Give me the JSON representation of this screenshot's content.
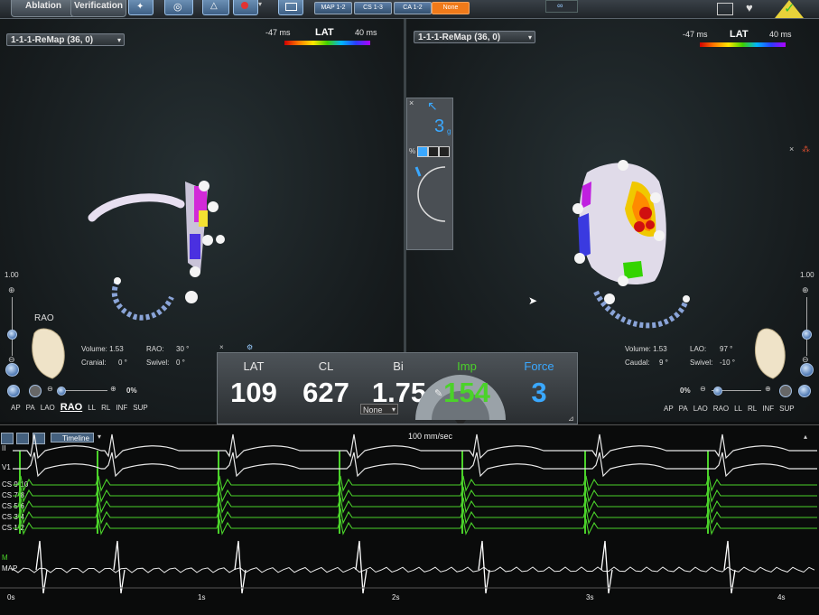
{
  "topbar": {
    "tabs": [
      "Ablation",
      "Verification"
    ],
    "seg_buttons": [
      "MAP 1-2",
      "CS 1-3",
      "CA 1-2",
      "None"
    ]
  },
  "left_pane": {
    "map_selector": "1-1-1-ReMap (36, 0)",
    "lat_title": "LAT",
    "lat_min": "-47 ms",
    "lat_max": "40 ms",
    "zoom_value": "1.00",
    "view_label": "RAO",
    "volume": "Volume: 1.53",
    "angle1_label": "RAO:",
    "angle1_value": "30 °",
    "angle2_label": "Cranial:",
    "angle2_value": "0 °",
    "angle3_label": "Swivel:",
    "angle3_value": "0 °",
    "opacity": "0%",
    "view_nav": [
      "AP",
      "PA",
      "LAO",
      "RAO",
      "LL",
      "RL",
      "INF",
      "SUP"
    ],
    "view_nav_selected": "RAO"
  },
  "right_pane": {
    "map_selector": "1-1-1-ReMap (36, 0)",
    "lat_title": "LAT",
    "lat_min": "-47 ms",
    "lat_max": "40 ms",
    "zoom_value": "1.00",
    "volume": "Volume: 1.53",
    "angle1_label": "LAO:",
    "angle1_value": "97 °",
    "angle2_label": "Caudal:",
    "angle2_value": "9 °",
    "angle3_label": "Swivel:",
    "angle3_value": "-10 °",
    "opacity": "0%",
    "view_nav": [
      "AP",
      "PA",
      "LAO",
      "RAO",
      "LL",
      "RL",
      "INF",
      "SUP"
    ]
  },
  "float_panel": {
    "close": "×",
    "value": "3",
    "unit": "g",
    "pct": "%"
  },
  "metrics": {
    "lat_label": "LAT",
    "lat_value": "109",
    "cl_label": "CL",
    "cl_value": "627",
    "bi_label": "Bi",
    "bi_value": "1.75",
    "imp_label": "Imp",
    "imp_value": "154",
    "force_label": "Force",
    "force_value": "3",
    "none_select": "None"
  },
  "ecg": {
    "timeline_label": "Timeline",
    "speed": "100 mm/sec",
    "channels": [
      "II",
      "V1",
      "CS 9-10",
      "CS 7-8",
      "CS 5-6",
      "CS 3-4",
      "CS 1-2",
      "M",
      "MAP"
    ],
    "time_ticks": [
      "0s",
      "1s",
      "2s",
      "3s",
      "4s"
    ]
  },
  "colors": {
    "accent_green": "#4bd22a",
    "force_blue": "#3aa8ff",
    "none_orange": "#f07a1a"
  }
}
